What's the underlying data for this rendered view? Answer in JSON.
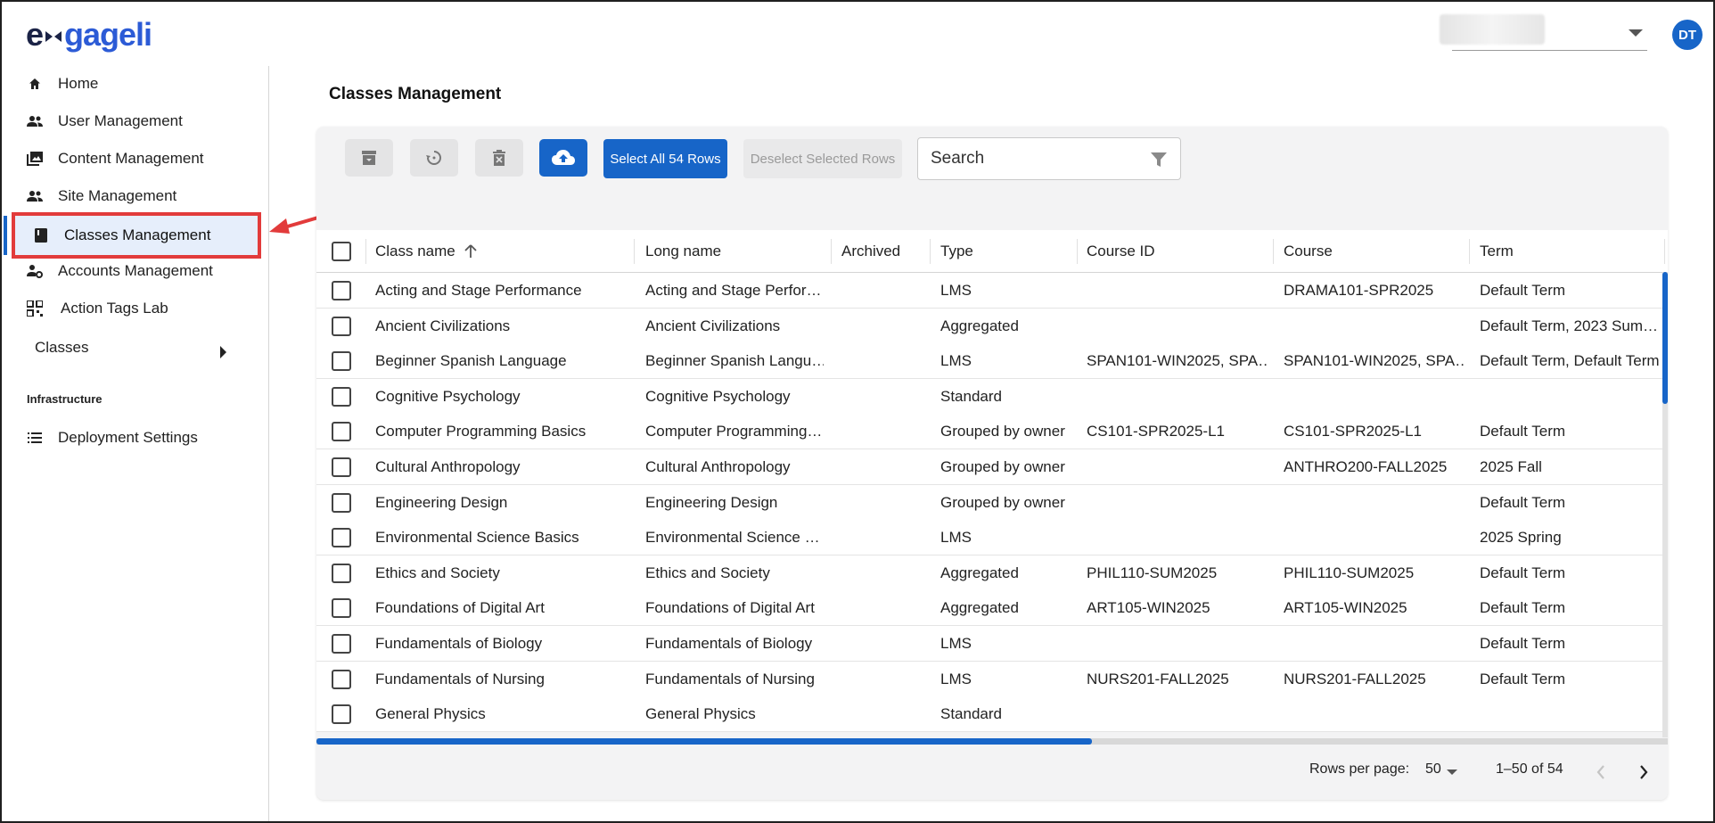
{
  "app": {
    "logo_prefix": "e",
    "logo_suffix": "gageli",
    "avatar_initials": "DT"
  },
  "sidebar": {
    "items": [
      {
        "label": "Home",
        "icon": "home-icon"
      },
      {
        "label": "User Management",
        "icon": "users-icon"
      },
      {
        "label": "Content Management",
        "icon": "photo-library-icon"
      },
      {
        "label": "Site Management",
        "icon": "users-icon"
      },
      {
        "label": "Classes Management",
        "icon": "book-icon"
      },
      {
        "label": "Accounts Management",
        "icon": "account-gear-icon"
      },
      {
        "label": "Action Tags Lab",
        "icon": "qr-icon"
      }
    ],
    "classes_label": "Classes",
    "section_label": "Infrastructure",
    "deployment_label": "Deployment Settings"
  },
  "main": {
    "title": "Classes Management",
    "select_all_label": "Select All 54 Rows",
    "deselect_label": "Deselect Selected Rows",
    "search_placeholder": "Search"
  },
  "table": {
    "columns": [
      "Class name",
      "Long name",
      "Archived",
      "Type",
      "Course ID",
      "Course",
      "Term"
    ],
    "rows": [
      [
        "Acting and Stage Performance",
        "Acting and Stage Perfor…",
        "",
        "LMS",
        "",
        "DRAMA101-SPR2025",
        "Default Term"
      ],
      [
        "Ancient Civilizations",
        "Ancient Civilizations",
        "",
        "Aggregated",
        "",
        "",
        "Default Term, 2023 Sum…"
      ],
      [
        "Beginner Spanish Language",
        "Beginner Spanish Langu…",
        "",
        "LMS",
        "SPAN101-WIN2025, SPA…",
        "SPAN101-WIN2025, SPA…",
        "Default Term, Default Term"
      ],
      [
        "Cognitive Psychology",
        "Cognitive Psychology",
        "",
        "Standard",
        "",
        "",
        ""
      ],
      [
        "Computer Programming Basics",
        "Computer Programming…",
        "",
        "Grouped by owner",
        "CS101-SPR2025-L1",
        "CS101-SPR2025-L1",
        "Default Term"
      ],
      [
        "Cultural Anthropology",
        "Cultural Anthropology",
        "",
        "Grouped by owner",
        "",
        "ANTHRO200-FALL2025",
        "2025 Fall"
      ],
      [
        "Engineering Design",
        "Engineering Design",
        "",
        "Grouped by owner",
        "",
        "",
        "Default Term"
      ],
      [
        "Environmental Science Basics",
        "Environmental Science …",
        "",
        "LMS",
        "",
        "",
        "2025 Spring"
      ],
      [
        "Ethics and Society",
        "Ethics and Society",
        "",
        "Aggregated",
        "PHIL110-SUM2025",
        "PHIL110-SUM2025",
        "Default Term"
      ],
      [
        "Foundations of Digital Art",
        "Foundations of Digital Art",
        "",
        "Aggregated",
        "ART105-WIN2025",
        "ART105-WIN2025",
        "Default Term"
      ],
      [
        "Fundamentals of Biology",
        "Fundamentals of Biology",
        "",
        "LMS",
        "",
        "",
        "Default Term"
      ],
      [
        "Fundamentals of Nursing",
        "Fundamentals of Nursing",
        "",
        "LMS",
        "NURS201-FALL2025",
        "NURS201-FALL2025",
        "Default Term"
      ],
      [
        "General Physics",
        "General Physics",
        "",
        "Standard",
        "",
        "",
        ""
      ]
    ]
  },
  "pagination": {
    "rows_per_page_label": "Rows per page:",
    "rows_per_page_value": "50",
    "range": "1–50 of 54"
  },
  "colors": {
    "accent": "#1765c8",
    "highlight_border": "#e23b3b"
  }
}
